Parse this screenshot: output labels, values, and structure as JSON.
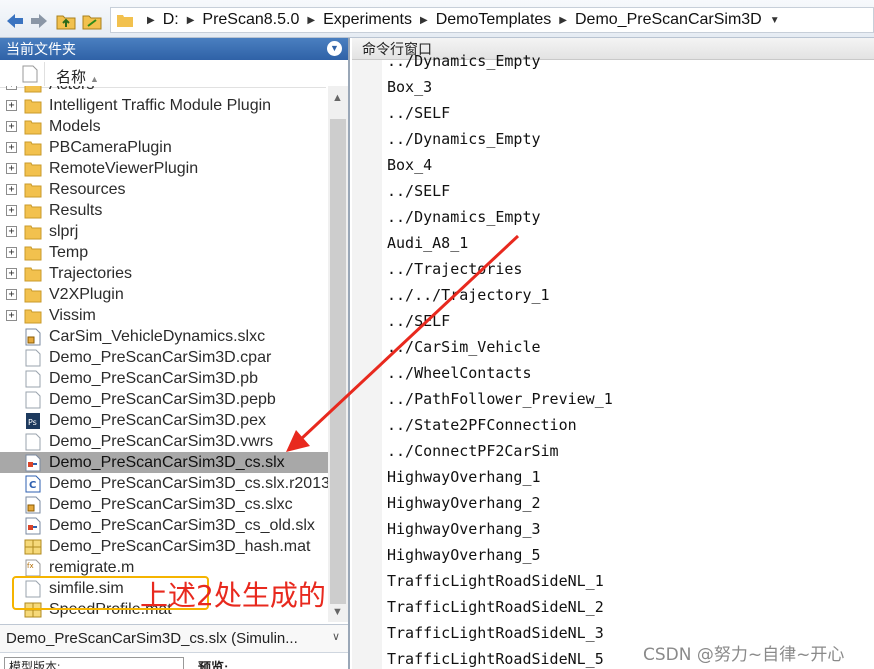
{
  "breadcrumb": {
    "drive": "D:",
    "path": [
      "PreScan8.5.0",
      "Experiments",
      "DemoTemplates",
      "Demo_PreScanCarSim3D"
    ]
  },
  "file_browser": {
    "title": "当前文件夹",
    "column_name": "名称",
    "items": [
      {
        "name": "Actors",
        "type": "folder",
        "expandable": true
      },
      {
        "name": "Intelligent Traffic Module Plugin",
        "type": "folder",
        "expandable": true
      },
      {
        "name": "Models",
        "type": "folder",
        "expandable": true
      },
      {
        "name": "PBCameraPlugin",
        "type": "folder",
        "expandable": true
      },
      {
        "name": "RemoteViewerPlugin",
        "type": "folder",
        "expandable": true
      },
      {
        "name": "Resources",
        "type": "folder",
        "expandable": true
      },
      {
        "name": "Results",
        "type": "folder",
        "expandable": true
      },
      {
        "name": "slprj",
        "type": "folder",
        "expandable": true
      },
      {
        "name": "Temp",
        "type": "folder",
        "expandable": true
      },
      {
        "name": "Trajectories",
        "type": "folder",
        "expandable": true
      },
      {
        "name": "V2XPlugin",
        "type": "folder",
        "expandable": true
      },
      {
        "name": "Vissim",
        "type": "folder",
        "expandable": true
      },
      {
        "name": "CarSim_VehicleDynamics.slxc",
        "type": "slxc"
      },
      {
        "name": "Demo_PreScanCarSim3D.cpar",
        "type": "file"
      },
      {
        "name": "Demo_PreScanCarSim3D.pb",
        "type": "file"
      },
      {
        "name": "Demo_PreScanCarSim3D.pepb",
        "type": "file"
      },
      {
        "name": "Demo_PreScanCarSim3D.pex",
        "type": "pex"
      },
      {
        "name": "Demo_PreScanCarSim3D.vwrs",
        "type": "file"
      },
      {
        "name": "Demo_PreScanCarSim3D_cs.slx",
        "type": "slx",
        "selected": true
      },
      {
        "name": "Demo_PreScanCarSim3D_cs.slx.r2013b",
        "type": "code"
      },
      {
        "name": "Demo_PreScanCarSim3D_cs.slxc",
        "type": "slxc"
      },
      {
        "name": "Demo_PreScanCarSim3D_cs_old.slx",
        "type": "slx"
      },
      {
        "name": "Demo_PreScanCarSim3D_hash.mat",
        "type": "mat"
      },
      {
        "name": "remigrate.m",
        "type": "m"
      },
      {
        "name": "simfile.sim",
        "type": "file"
      },
      {
        "name": "SpeedProfile.mat",
        "type": "mat"
      }
    ],
    "detail_label": "Demo_PreScanCarSim3D_cs.slx (Simulin...",
    "preview_label": "预览:",
    "model_label": "模型版本:"
  },
  "command_window": {
    "title": "命令行窗口",
    "lines": [
      "../Dynamics_Empty",
      "Box_3",
      "../SELF",
      "../Dynamics_Empty",
      "Box_4",
      "../SELF",
      "../Dynamics_Empty",
      "Audi_A8_1",
      "../Trajectories",
      "../../Trajectory_1",
      "../SELF",
      "../CarSim_Vehicle",
      "../WheelContacts",
      "../PathFollower_Preview_1",
      "../State2PFConnection",
      "../ConnectPF2CarSim",
      "HighwayOverhang_1",
      "HighwayOverhang_2",
      "HighwayOverhang_3",
      "HighwayOverhang_5",
      "TrafficLightRoadSideNL_1",
      "TrafficLightRoadSideNL_2",
      "TrafficLightRoadSideNL_3",
      "TrafficLightRoadSideNL_5"
    ]
  },
  "annotation": {
    "text": "上述2处生成的",
    "color": "#e8291e",
    "box_color": "#f5b400"
  },
  "watermark": "CSDN @努力~自律~开心"
}
